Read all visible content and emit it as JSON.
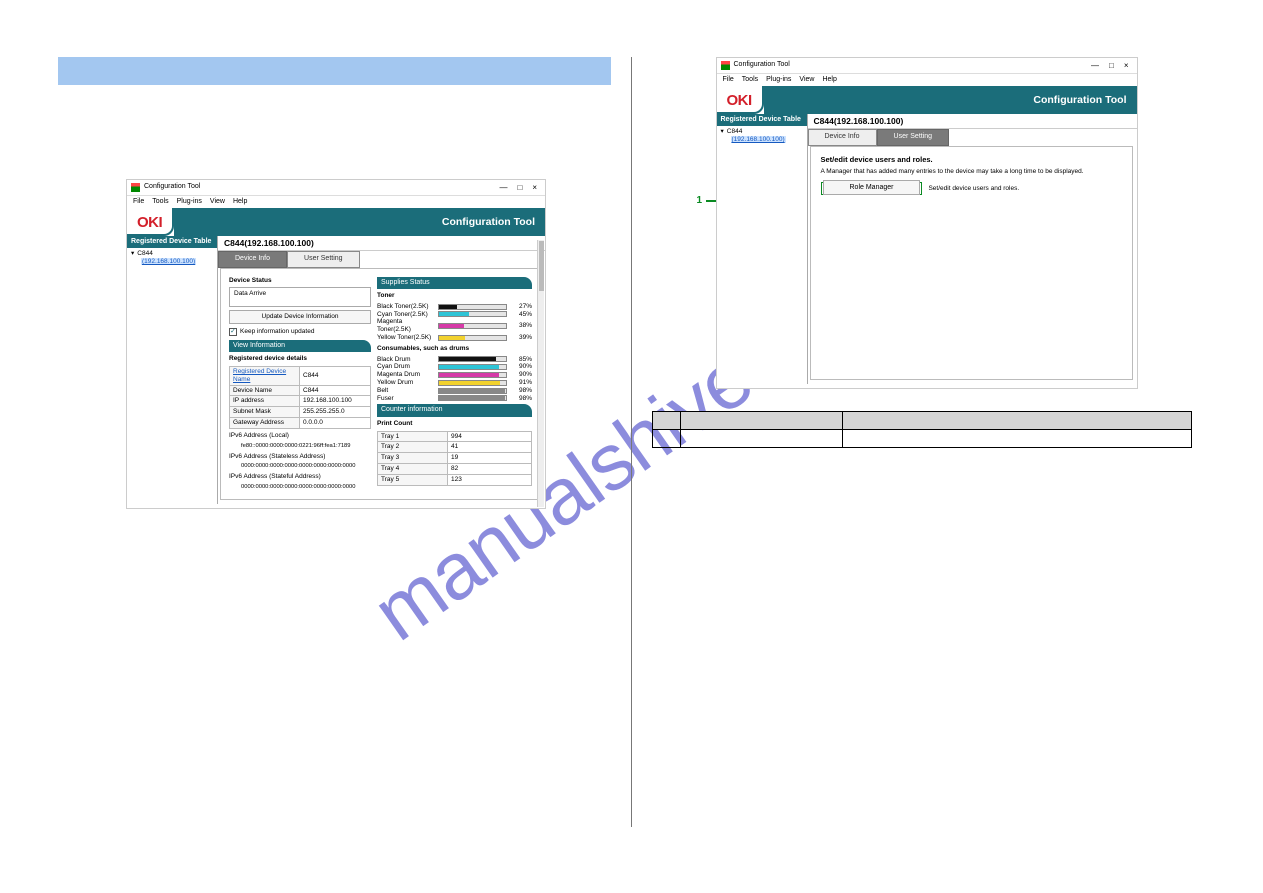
{
  "watermark": "manualshive.com",
  "app": {
    "title": "Configuration Tool",
    "menus": [
      "File",
      "Tools",
      "Plug-ins",
      "View",
      "Help"
    ],
    "brand": "OKI",
    "banner": "Configuration Tool",
    "left_pane_header": "Registered Device Table",
    "tree_device": "C844",
    "tree_ip": "(192.168.100.100)",
    "device_title": "C844(192.168.100.100)",
    "tabs": {
      "device_info": "Device Info",
      "user_setting": "User Setting"
    },
    "window_controls": {
      "min": "—",
      "max": "□",
      "close": "×"
    }
  },
  "left_screenshot": {
    "device_status_label": "Device Status",
    "device_status_value": "Data Arrive",
    "update_btn": "Update Device Information",
    "keep_updated": "Keep information updated",
    "view_info": "View Information",
    "details_header": "Registered device details",
    "details": [
      {
        "k": "Registered Device Name",
        "v": "C844",
        "link": true
      },
      {
        "k": "Device Name",
        "v": "C844"
      },
      {
        "k": "IP address",
        "v": "192.168.100.100"
      },
      {
        "k": "Subnet Mask",
        "v": "255.255.255.0"
      },
      {
        "k": "Gateway Address",
        "v": "0.0.0.0"
      }
    ],
    "ipv6_local": "IPv6 Address (Local)",
    "ipv6_local_v": "fe80::0000:0000:0000:0221:96ff:fea1:7189",
    "ipv6_stateless": "IPv6 Address (Stateless Address)",
    "ipv6_stateless_v": "0000:0000:0000:0000:0000:0000:0000:0000",
    "ipv6_stateful": "IPv6 Address (Stateful Address)",
    "ipv6_stateful_v": "0000:0000:0000:0000:0000:0000:0000:0000",
    "supplies_header": "Supplies Status",
    "toner_header": "Toner",
    "toners": [
      {
        "name": "Black Toner(2.5K)",
        "pct": 27,
        "color": "#111"
      },
      {
        "name": "Cyan Toner(2.5K)",
        "pct": 45,
        "color": "#2ec4d6"
      },
      {
        "name": "Magenta Toner(2.5K)",
        "pct": 38,
        "color": "#d63aa8"
      },
      {
        "name": "Yellow Toner(2.5K)",
        "pct": 39,
        "color": "#f2d22e"
      }
    ],
    "consumables_header": "Consumables, such as drums",
    "drums": [
      {
        "name": "Black Drum",
        "pct": 85,
        "color": "#111"
      },
      {
        "name": "Cyan Drum",
        "pct": 90,
        "color": "#2ec4d6"
      },
      {
        "name": "Magenta Drum",
        "pct": 90,
        "color": "#d63aa8"
      },
      {
        "name": "Yellow Drum",
        "pct": 91,
        "color": "#f2d22e"
      },
      {
        "name": "Belt",
        "pct": 98,
        "color": "#888"
      },
      {
        "name": "Fuser",
        "pct": 98,
        "color": "#888"
      }
    ],
    "counter_header": "Counter information",
    "print_count_header": "Print Count",
    "trays": [
      {
        "name": "Tray 1",
        "v": "994"
      },
      {
        "name": "Tray 2",
        "v": "41"
      },
      {
        "name": "Tray 3",
        "v": "19"
      },
      {
        "name": "Tray 4",
        "v": "82"
      },
      {
        "name": "Tray 5",
        "v": "123"
      }
    ]
  },
  "right_screenshot": {
    "heading": "Set/edit device users and roles.",
    "note": "A Manager that has added many entries to the device may take a long time to be displayed.",
    "role_manager_btn": "Role Manager",
    "role_manager_note": "Set/edit device users and roles.",
    "callout_number": "1"
  },
  "def_table": {
    "headers": [
      "",
      "",
      ""
    ],
    "rows": [
      [
        "",
        "",
        ""
      ]
    ]
  }
}
